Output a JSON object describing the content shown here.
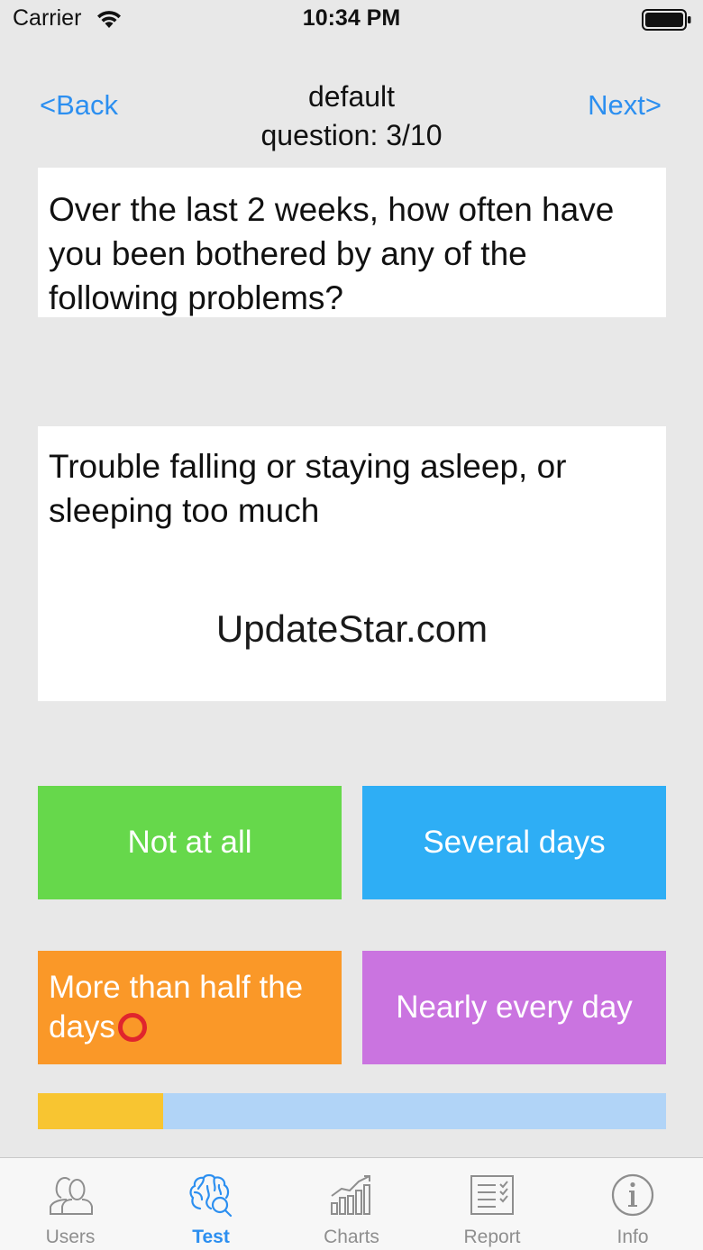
{
  "status_bar": {
    "carrier": "Carrier",
    "time": "10:34 PM",
    "wifi_icon": "wifi-icon",
    "battery_icon": "battery-icon"
  },
  "nav": {
    "back_label": "<Back",
    "next_label": "Next>",
    "title": "default",
    "subtitle": "question: 3/10"
  },
  "prompt": "Over the last 2 weeks, how often have you been bothered by any of the following problems?",
  "question": {
    "text": "Trouble falling or staying asleep, or sleeping too much",
    "watermark": "UpdateStar.com"
  },
  "answers": [
    {
      "label": "Not at all",
      "color": "#66d84b"
    },
    {
      "label": "Several days",
      "color": "#2eaef5"
    },
    {
      "label": "More than half the days",
      "color": "#fa9828",
      "selected": true,
      "selected_icon": "red-circle-icon"
    },
    {
      "label": "Nearly every day",
      "color": "#ca74e0"
    }
  ],
  "progress": {
    "current": 3,
    "total": 10,
    "fraction": 0.2,
    "fill_color": "#f8c531",
    "track_color": "#b1d4f7"
  },
  "tabs": [
    {
      "label": "Users",
      "icon": "users-icon",
      "active": false
    },
    {
      "label": "Test",
      "icon": "brain-icon",
      "active": true
    },
    {
      "label": "Charts",
      "icon": "bar-chart-icon",
      "active": false
    },
    {
      "label": "Report",
      "icon": "report-icon",
      "active": false
    },
    {
      "label": "Info",
      "icon": "info-icon",
      "active": false
    }
  ],
  "colors": {
    "accent": "#2c8ff0",
    "background": "#e8e8e8"
  }
}
